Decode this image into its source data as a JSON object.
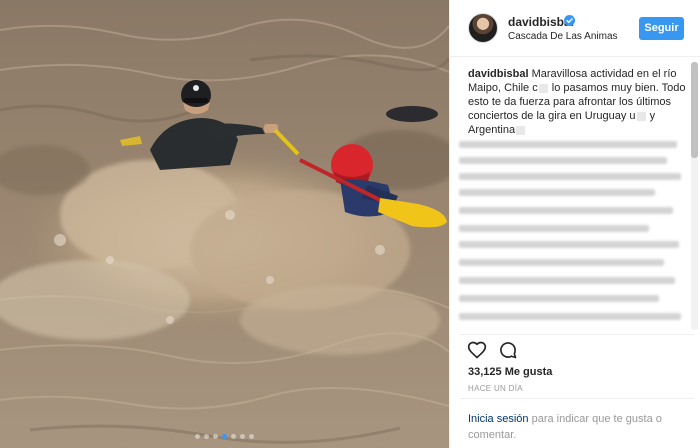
{
  "post": {
    "photo": {
      "description_icon": "rafting-photo",
      "carousel_total": 7,
      "carousel_active_index": 3
    },
    "header": {
      "username": "davidbisbal",
      "location": "Cascada De Las Animas",
      "follow_label": "Seguir",
      "verified_icon": "verified-badge-icon"
    },
    "caption": {
      "author": "davidbisbal",
      "text_part1": "Maravillosa actividad en el río Maipo, Chile c",
      "text_part2": " lo pasamos muy bien. Todo esto te da fuerza para afrontar los últimos conciertos de la gira en Uruguay u",
      "text_part3": " y Argentina"
    },
    "likes": "33,125 Me gusta",
    "timestamp": "HACE UN DÍA",
    "login": {
      "link": "Inicia sesión",
      "rest": " para indicar que te gusta o comentar."
    },
    "colors": {
      "accent": "#3897f0",
      "link": "#003569",
      "muted": "#999999"
    }
  }
}
